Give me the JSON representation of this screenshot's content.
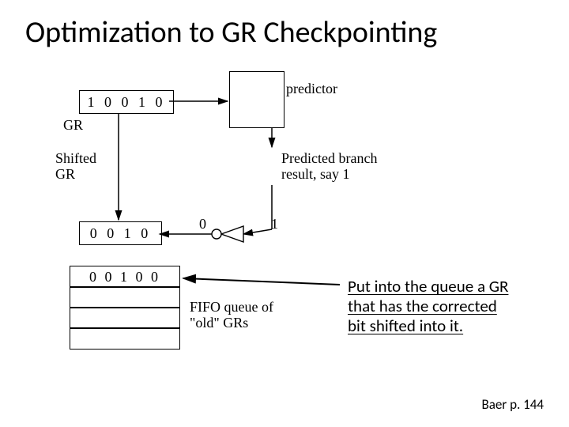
{
  "title": "Optimization to GR Checkpointing",
  "gr_box": "1 0 0 1 0",
  "gr_label": "GR",
  "shifted_gr_label_1": "Shifted",
  "shifted_gr_label_2": "GR",
  "shifted_gr_box": "0 0 1 0",
  "predictor_label": "predictor",
  "predicted_label_1": "Predicted branch",
  "predicted_label_2": "result, say 1",
  "bit_zero": "0",
  "bit_one": "1",
  "queue_entry": "0 0 1 0 0",
  "fifo_label_1": "FIFO queue of",
  "fifo_label_2": "\"old\" GRs",
  "annotation_1": "Put into the queue a GR",
  "annotation_2": "that has the corrected",
  "annotation_3": "bit shifted into it.",
  "citation": "Baer p. 144"
}
